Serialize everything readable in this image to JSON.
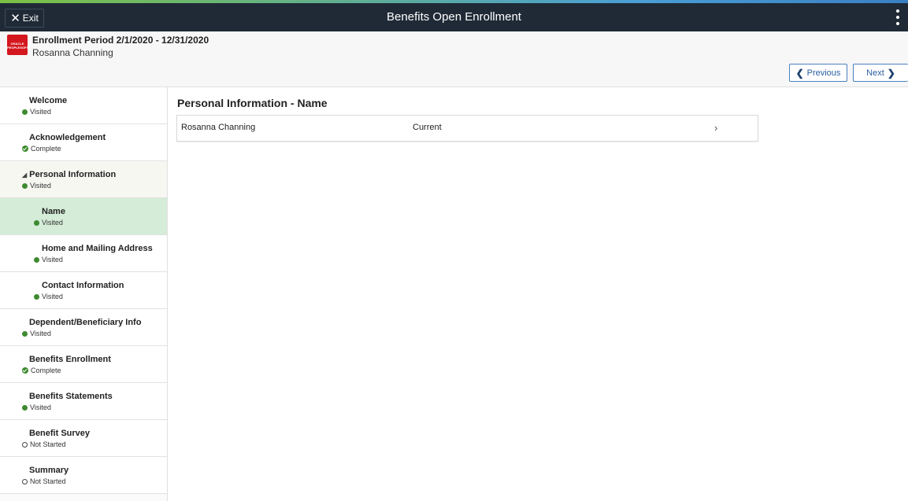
{
  "banner": {
    "exit_label": "Exit",
    "title": "Benefits Open Enrollment"
  },
  "header": {
    "logo_text": "ORACLE PEOPLESOFT",
    "period": "Enrollment Period 2/1/2020 - 12/31/2020",
    "person": "Rosanna Channing",
    "prev_label": "Previous",
    "next_label": "Next"
  },
  "sidebar": {
    "items": [
      {
        "label": "Welcome",
        "status": "Visited",
        "status_type": "visited"
      },
      {
        "label": "Acknowledgement",
        "status": "Complete",
        "status_type": "complete"
      },
      {
        "label": "Personal Information",
        "status": "Visited",
        "status_type": "visited",
        "expanded": true
      },
      {
        "label": "Name",
        "status": "Visited",
        "status_type": "visited",
        "sub": true,
        "active": true
      },
      {
        "label": "Home and Mailing Address",
        "status": "Visited",
        "status_type": "visited",
        "sub": true
      },
      {
        "label": "Contact Information",
        "status": "Visited",
        "status_type": "visited",
        "sub": true
      },
      {
        "label": "Dependent/Beneficiary Info",
        "status": "Visited",
        "status_type": "visited"
      },
      {
        "label": "Benefits Enrollment",
        "status": "Complete",
        "status_type": "complete"
      },
      {
        "label": "Benefits Statements",
        "status": "Visited",
        "status_type": "visited"
      },
      {
        "label": "Benefit Survey",
        "status": "Not Started",
        "status_type": "not-started"
      },
      {
        "label": "Summary",
        "status": "Not Started",
        "status_type": "not-started"
      }
    ]
  },
  "main": {
    "title": "Personal Information - Name",
    "rows": [
      {
        "name": "Rosanna Channing",
        "status": "Current"
      }
    ]
  },
  "colors": {
    "banner": "#1f2a36",
    "active_item": "#d4ecd8",
    "status_green": "#3d8a2f",
    "button_blue": "#2a5ea0",
    "logo_red": "#d4171e"
  }
}
